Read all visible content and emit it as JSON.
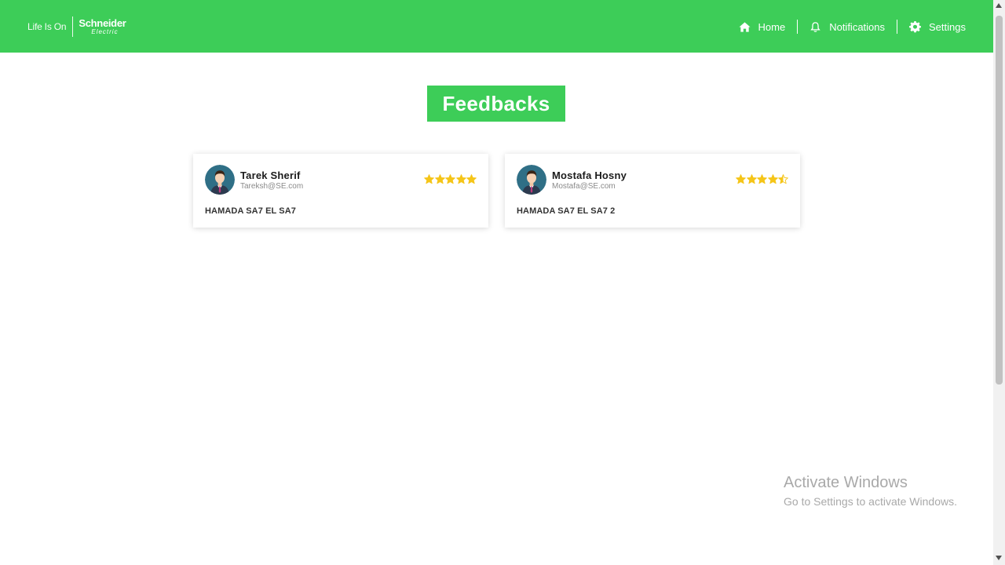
{
  "header": {
    "logo_tagline": "Life Is On",
    "logo_brand": "Schneider",
    "logo_brand_sub": "Electric",
    "nav": [
      {
        "label": "Home",
        "icon": "home-icon"
      },
      {
        "label": "Notifications",
        "icon": "bell-icon"
      },
      {
        "label": "Settings",
        "icon": "gear-icon"
      }
    ],
    "bg_color": "#3dcd58"
  },
  "main": {
    "title": "Feedbacks",
    "feedbacks": [
      {
        "name": "Tarek Sherif",
        "email": "Tareksh@SE.com",
        "rating": 5,
        "comment": "HAMADA SA7 EL SA7"
      },
      {
        "name": "Mostafa Hosny",
        "email": "Mostafa@SE.com",
        "rating": 4.5,
        "comment": "HAMADA SA7 EL SA7 2"
      }
    ],
    "star_color": "#f5c518"
  },
  "watermark": {
    "line1": "Activate Windows",
    "line2": "Go to Settings to activate Windows."
  }
}
